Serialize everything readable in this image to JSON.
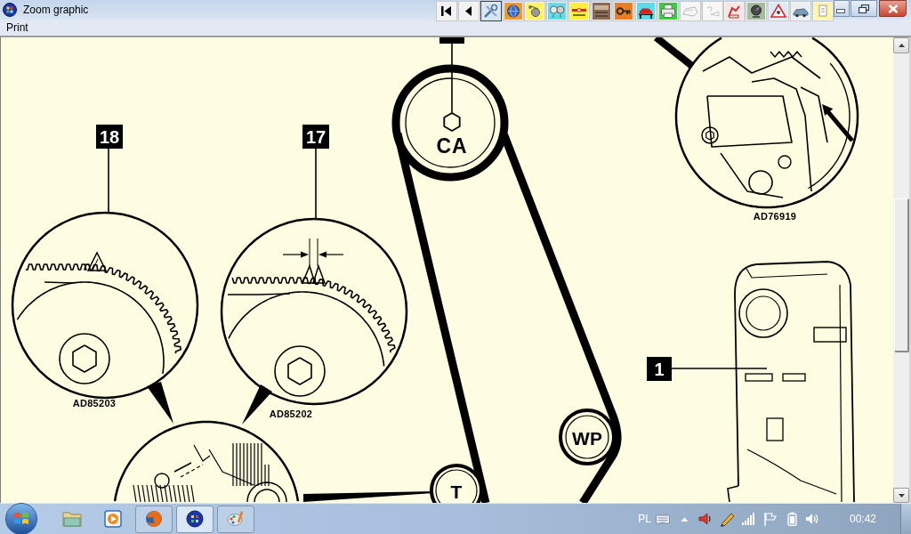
{
  "window": {
    "title": "Zoom graphic"
  },
  "toolbar": [
    {
      "kind": "first",
      "selected": false
    },
    {
      "kind": "previous",
      "selected": false
    },
    {
      "kind": "tools",
      "selected": true
    },
    {
      "kind": "globe",
      "selected": false
    },
    {
      "kind": "pulley",
      "selected": false
    },
    {
      "kind": "pulleys",
      "selected": false
    },
    {
      "kind": "cable",
      "selected": false
    },
    {
      "kind": "engine",
      "selected": false
    },
    {
      "kind": "key",
      "selected": false
    },
    {
      "kind": "lift",
      "selected": false
    },
    {
      "kind": "printer",
      "selected": false
    },
    {
      "kind": "outline",
      "selected": false
    },
    {
      "kind": "help",
      "selected": false
    },
    {
      "kind": "mechanic",
      "selected": false
    },
    {
      "kind": "gauge",
      "selected": false
    },
    {
      "kind": "warning",
      "selected": false
    },
    {
      "kind": "car",
      "selected": false
    },
    {
      "kind": "document",
      "selected": false
    }
  ],
  "menu": [
    "Print"
  ],
  "diagram": {
    "callouts": [
      {
        "number": "18"
      },
      {
        "number": "17"
      },
      {
        "number": "1"
      }
    ],
    "pulleys": [
      {
        "label": "CA"
      },
      {
        "label": "WP"
      },
      {
        "label": "T"
      }
    ],
    "detail_views": [
      {
        "code": "AD85203"
      },
      {
        "code": "AD85202"
      },
      {
        "code": "AD76919"
      }
    ]
  },
  "taskbar": {
    "apps": [
      {
        "kind": "folder",
        "running": false,
        "selected": false
      },
      {
        "kind": "media",
        "running": false,
        "selected": false
      },
      {
        "kind": "browser",
        "running": true,
        "selected": false
      },
      {
        "kind": "app",
        "running": true,
        "selected": true
      },
      {
        "kind": "paint",
        "running": true,
        "selected": false
      }
    ],
    "tray": {
      "language": "PL",
      "icons": [
        {
          "kind": "keyboard"
        },
        {
          "kind": "overflow"
        },
        {
          "kind": "speaker"
        },
        {
          "kind": "pen"
        },
        {
          "kind": "signal"
        },
        {
          "kind": "flag"
        },
        {
          "kind": "battery"
        },
        {
          "kind": "volume"
        }
      ],
      "time": "00:42"
    }
  }
}
